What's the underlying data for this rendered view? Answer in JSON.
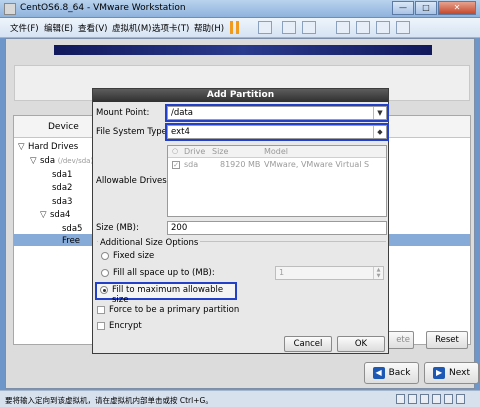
{
  "window": {
    "title": "CentOS6.8_64 - VMware Workstation",
    "minimize": "—",
    "maximize": "□",
    "close": "✕"
  },
  "menubar": {
    "items": [
      "文件(F)",
      "编辑(E)",
      "查看(V)",
      "虚拟机(M)",
      "选项卡(T)",
      "帮助(H)"
    ]
  },
  "installer": {
    "device_header": "Device",
    "tree": [
      {
        "label": "Hard Drives",
        "expander": "▽"
      },
      {
        "label": "sda",
        "sub": "(/dev/sda)",
        "expander": "▽"
      },
      {
        "label": "sda1"
      },
      {
        "label": "sda2"
      },
      {
        "label": "sda3"
      },
      {
        "label": "sda4",
        "expander": "▽"
      },
      {
        "label": "sda5"
      },
      {
        "label": "Free"
      }
    ],
    "delete_label": "ete",
    "reset_label": "Reset",
    "back_label": "Back",
    "next_label": "Next"
  },
  "dialog": {
    "title": "Add Partition",
    "mount_point_label": "Mount Point:",
    "mount_point_value": "/data",
    "fs_type_label": "File System Type:",
    "fs_type_value": "ext4",
    "allowable_drives_label": "Allowable Drives:",
    "drives_columns": [
      "Drive",
      "Size",
      "Model"
    ],
    "drives_rows": [
      {
        "checked": true,
        "drive": "sda",
        "size": "81920 MB",
        "model": "VMware, VMware Virtual S"
      }
    ],
    "size_label": "Size (MB):",
    "size_value": "200",
    "additional_size_label": "Additional Size Options",
    "opt_fixed": "Fixed size",
    "opt_fill_upto": "Fill all space up to (MB):",
    "fill_upto_value": "1",
    "opt_fill_max": "Fill to maximum allowable size",
    "selected_option": "fill_max",
    "primary_label": "Force to be a primary partition",
    "encrypt_label": "Encrypt",
    "cancel_label": "Cancel",
    "ok_label": "OK"
  },
  "status": {
    "text": "要将输入定向到该虚拟机，请在虚拟机内部单击或按 Ctrl+G。"
  },
  "colors": {
    "highlight": "#2340c8",
    "selection": "#86abd9",
    "banner": "#12195c"
  }
}
